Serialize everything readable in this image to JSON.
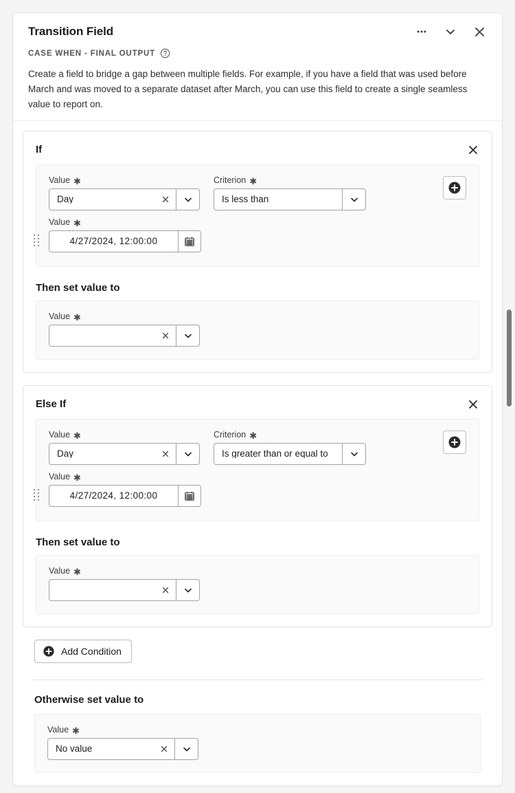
{
  "header": {
    "title": "Transition Field",
    "subtitle": "CASE WHEN - FINAL OUTPUT",
    "help_icon": "question-circle-icon",
    "more_icon": "ellipsis-icon",
    "collapse_icon": "chevron-down-icon",
    "close_icon": "close-icon",
    "description": "Create a field to bridge a gap between multiple fields. For example, if you have a field that was used before March and was moved to a separate dataset after March, you can use this field to create a single seamless value to report on."
  },
  "labels": {
    "value": "Value",
    "criterion": "Criterion",
    "required_mark": "✱",
    "then_set_value_to": "Then set value to",
    "otherwise_set_value_to": "Otherwise set value to",
    "add_condition": "Add Condition",
    "clear_icon": "clear-x-icon",
    "dropdown_icon": "chevron-down-icon",
    "calendar_icon": "calendar-icon",
    "plus_icon": "plus-circle-icon",
    "drag_icon": "drag-handle-icon",
    "close_icon": "close-icon"
  },
  "conditions": [
    {
      "title": "If",
      "value_field": "Day",
      "criterion_field": "Is less than",
      "date_field": "4/27/2024, 12:00:00",
      "then_value": ""
    },
    {
      "title": "Else If",
      "value_field": "Day",
      "criterion_field": "Is greater than or equal to",
      "date_field": "4/27/2024, 12:00:00",
      "then_value": ""
    }
  ],
  "otherwise": {
    "value_field": "No value"
  },
  "colors": {
    "panel_bg": "#ffffff",
    "page_bg": "#f5f5f5",
    "group_bg": "#fafafa",
    "border": "#e0e0e0",
    "input_border": "#a2a2a2",
    "text": "#1b1b1b",
    "scrollbar_thumb": "#7a7a7a"
  }
}
